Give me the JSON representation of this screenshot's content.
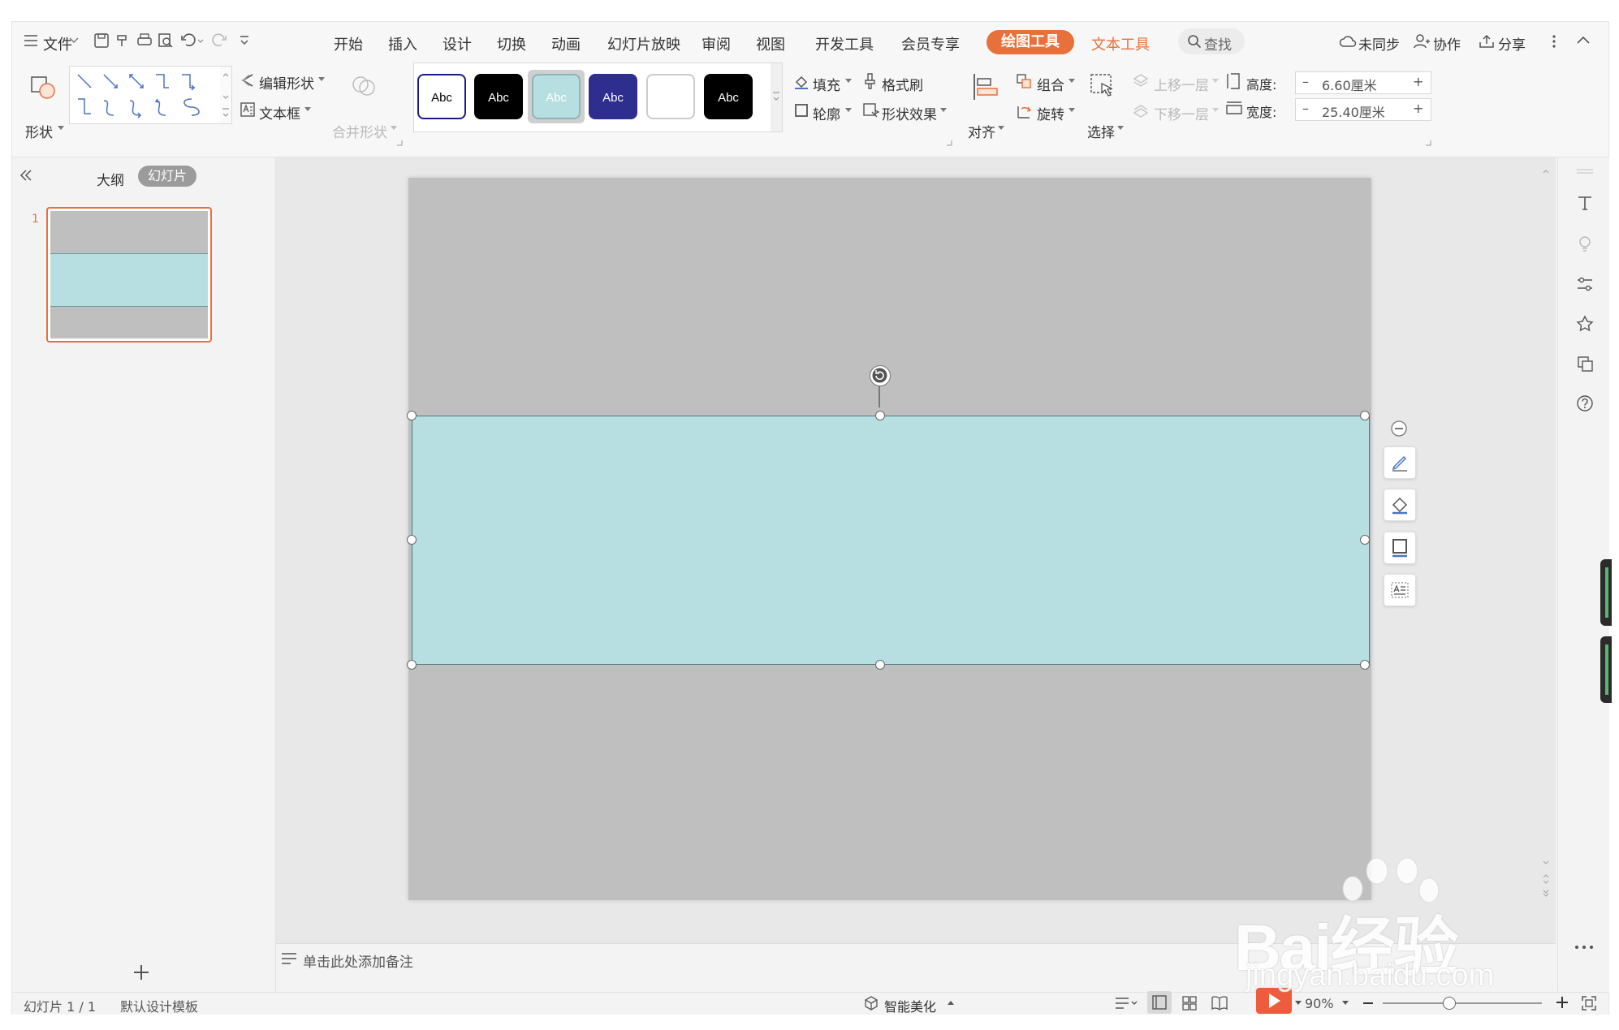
{
  "menu": {
    "file": "文件",
    "tabs": [
      "开始",
      "插入",
      "设计",
      "切换",
      "动画",
      "幻灯片放映",
      "审阅",
      "视图",
      "开发工具",
      "会员专享"
    ],
    "active_tab": "绘图工具",
    "text_tools": "文本工具",
    "search": "查找",
    "sync": "未同步",
    "collab": "协作",
    "share": "分享"
  },
  "ribbon": {
    "shape": "形状",
    "edit_shape": "编辑形状",
    "text_box": "文本框",
    "merge_shape": "合并形状",
    "styles": [
      {
        "label": "Abc",
        "bg": "#ffffff",
        "fg": "#000000",
        "border": "#1a1a8c"
      },
      {
        "label": "Abc",
        "bg": "#000000",
        "fg": "#ffffff",
        "border": "#000000"
      },
      {
        "label": "Abc",
        "bg": "#b7dee1",
        "fg": "#ffffff",
        "border": "#8fb5b8"
      },
      {
        "label": "Abc",
        "bg": "#2e2e8e",
        "fg": "#ffffff",
        "border": "#2e2e8e"
      },
      {
        "label": "",
        "bg": "#ffffff",
        "fg": "#000000",
        "border": "#cccccc"
      },
      {
        "label": "Abc",
        "bg": "#000000",
        "fg": "#ffffff",
        "border": "#000000"
      }
    ],
    "fill": "填充",
    "format_painter": "格式刷",
    "outline": "轮廓",
    "shape_effect": "形状效果",
    "align": "对齐",
    "group": "组合",
    "rotate": "旋转",
    "select": "选择",
    "bring_forward": "上移一层",
    "send_backward": "下移一层",
    "height_label": "高度:",
    "height_value": "6.60厘米",
    "width_label": "宽度:",
    "width_value": "25.40厘米"
  },
  "left_panel": {
    "outline_tab": "大纲",
    "slides_tab": "幻灯片",
    "slide_number": "1"
  },
  "notes_placeholder": "单击此处添加备注",
  "status": {
    "slide_info": "幻灯片 1 / 1",
    "template": "默认设计模板",
    "smart_beautify": "智能美化",
    "zoom": "90%"
  },
  "watermark": {
    "brand": "Bai经验",
    "url": "jingyan.baidu.com"
  },
  "colors": {
    "accent": "#e8703b",
    "slide_bg": "#bfbfbf",
    "shape_fill": "#b7dee1"
  }
}
